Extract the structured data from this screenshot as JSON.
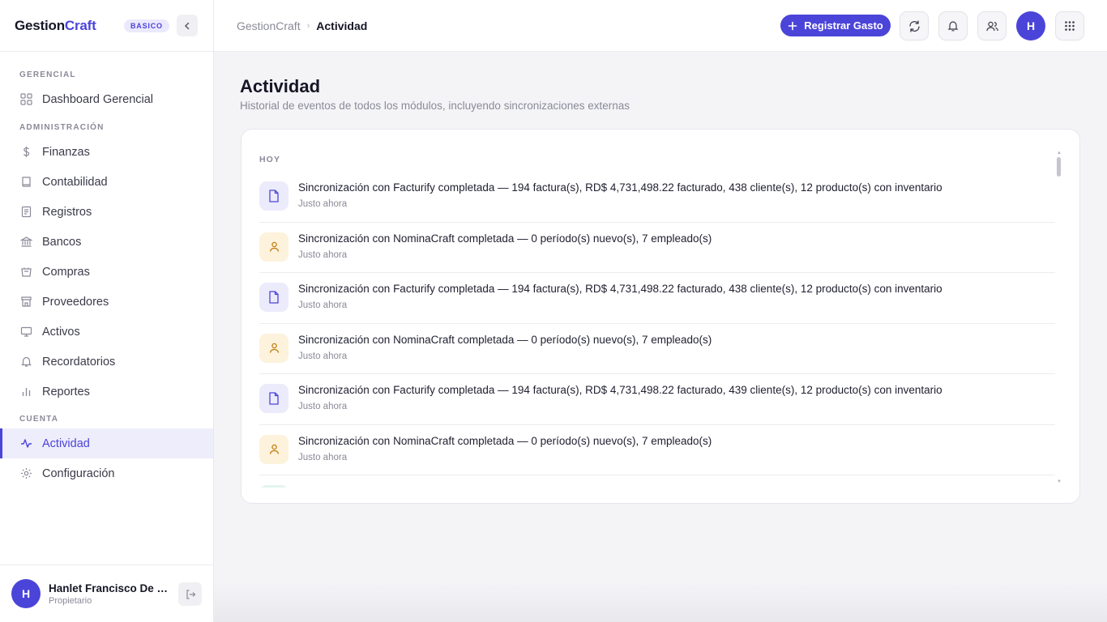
{
  "sidebar": {
    "brand_part1": "Gestion",
    "brand_part2": "Craft",
    "plan_badge": "BASICO",
    "sections": {
      "gerencial": "GERENCIAL",
      "administracion": "ADMINISTRACIÓN",
      "cuenta": "CUENTA"
    },
    "items": [
      {
        "label": "Dashboard Gerencial",
        "icon": "grid-icon"
      },
      {
        "label": "Finanzas",
        "icon": "dollar-icon"
      },
      {
        "label": "Contabilidad",
        "icon": "book-icon"
      },
      {
        "label": "Registros",
        "icon": "document-list-icon"
      },
      {
        "label": "Bancos",
        "icon": "bank-icon"
      },
      {
        "label": "Compras",
        "icon": "basket-icon"
      },
      {
        "label": "Proveedores",
        "icon": "store-icon"
      },
      {
        "label": "Activos",
        "icon": "monitor-icon"
      },
      {
        "label": "Recordatorios",
        "icon": "bell-icon"
      },
      {
        "label": "Reportes",
        "icon": "bar-chart-icon"
      },
      {
        "label": "Actividad",
        "icon": "activity-icon",
        "active": true
      },
      {
        "label": "Configuración",
        "icon": "gear-icon"
      }
    ],
    "user": {
      "initial": "H",
      "name": "Hanlet Francisco De L...",
      "role": "Propietario"
    }
  },
  "topbar": {
    "breadcrumb_root": "GestionCraft",
    "breadcrumb_current": "Actividad",
    "primary_button": "Registrar Gasto",
    "avatar_initial": "H"
  },
  "page": {
    "title": "Actividad",
    "subtitle": "Historial de eventos de todos los módulos, incluyendo sincronizaciones externas",
    "group_label": "HOY",
    "events": [
      {
        "text": "Sincronización con Facturify completada — 194 factura(s), RD$ 4,731,498.22 facturado, 438 cliente(s), 12 producto(s) con inventario",
        "time": "Justo ahora",
        "kind": "doc"
      },
      {
        "text": "Sincronización con NominaCraft completada — 0 período(s) nuevo(s), 7 empleado(s)",
        "time": "Justo ahora",
        "kind": "person"
      },
      {
        "text": "Sincronización con Facturify completada — 194 factura(s), RD$ 4,731,498.22 facturado, 438 cliente(s), 12 producto(s) con inventario",
        "time": "Justo ahora",
        "kind": "doc"
      },
      {
        "text": "Sincronización con NominaCraft completada — 0 período(s) nuevo(s), 7 empleado(s)",
        "time": "Justo ahora",
        "kind": "person"
      },
      {
        "text": "Sincronización con Facturify completada — 194 factura(s), RD$ 4,731,498.22 facturado, 439 cliente(s), 12 producto(s) con inventario",
        "time": "Justo ahora",
        "kind": "doc"
      },
      {
        "text": "Sincronización con NominaCraft completada — 0 período(s) nuevo(s), 7 empleado(s)",
        "time": "Justo ahora",
        "kind": "person"
      }
    ]
  },
  "colors": {
    "accent": "#4b44d9",
    "doc_icon_bg": "#ecebfb",
    "person_icon_bg": "#fdf2dc"
  }
}
